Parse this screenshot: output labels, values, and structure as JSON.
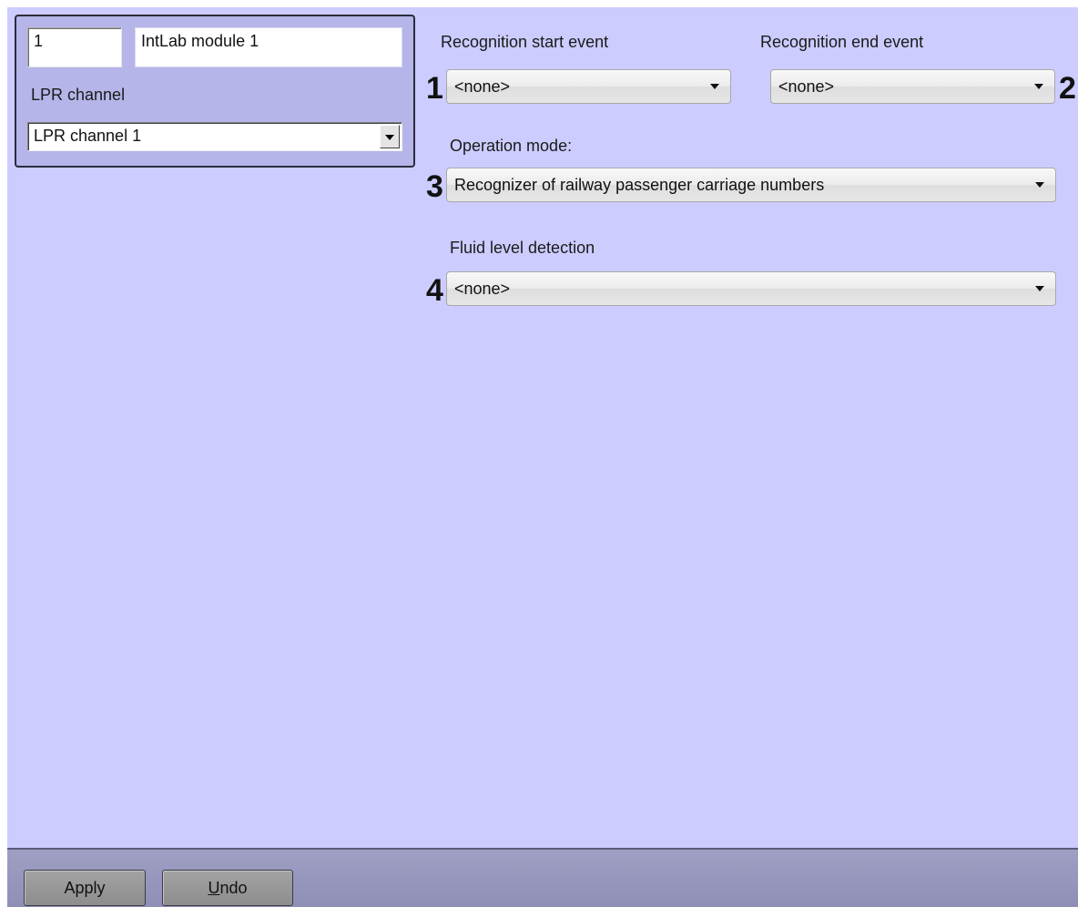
{
  "object": {
    "id": "1",
    "name": "IntLab module 1",
    "lpr_channel_label": "LPR channel",
    "lpr_channel_value": "LPR channel 1"
  },
  "fields": {
    "recognition_start": {
      "label": "Recognition start event",
      "value": "<none>",
      "marker": "1"
    },
    "recognition_end": {
      "label": "Recognition end event",
      "value": "<none>",
      "marker": "2"
    },
    "operation_mode": {
      "label": "Operation mode:",
      "value": "Recognizer of railway passenger carriage numbers",
      "marker": "3"
    },
    "fluid_level": {
      "label": "Fluid level detection",
      "value": "<none>",
      "marker": "4"
    }
  },
  "footer": {
    "apply_label": "Apply",
    "undo_mnemonic": "U",
    "undo_rest": "ndo"
  },
  "icons": {
    "dropdown": "chevron-down-icon"
  },
  "colors": {
    "panel_background": "#ccccff",
    "group_background": "#b5b5ea",
    "footer_background": "#9999bf"
  }
}
